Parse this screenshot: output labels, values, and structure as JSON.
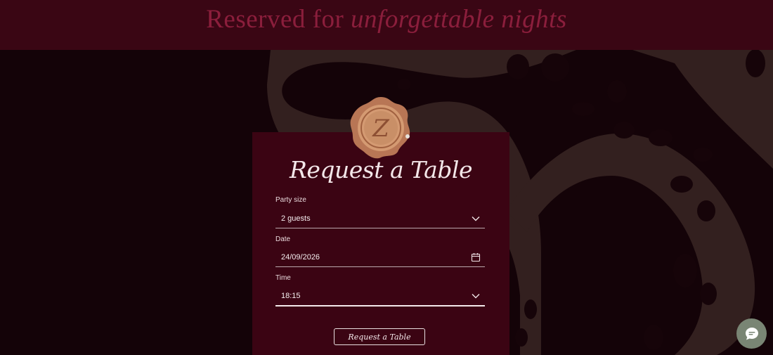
{
  "banner": {
    "title_plain": "Reserved for ",
    "title_accent": "unforgettable nights"
  },
  "seal": {
    "icon": "wax-seal-icon",
    "letter": "Z"
  },
  "form": {
    "title": "Request a Table",
    "party_size": {
      "label": "Party size",
      "value": "2 guests",
      "icon": "chevron-down-icon"
    },
    "date": {
      "label": "Date",
      "value": "24/09/2026",
      "icon": "calendar-icon"
    },
    "time": {
      "label": "Time",
      "value": "18:15",
      "icon": "chevron-down-icon"
    },
    "submit_label": "Request a Table"
  },
  "chat": {
    "icon": "chat-bubble-icon"
  },
  "colors": {
    "banner_bg": "#3a0614",
    "banner_text": "#8b1e3c",
    "page_bg": "#140308",
    "card_bg": "#3b0413",
    "pattern": "#33201f",
    "chat_bg": "#798574",
    "seal_gold": "#c98f67"
  }
}
